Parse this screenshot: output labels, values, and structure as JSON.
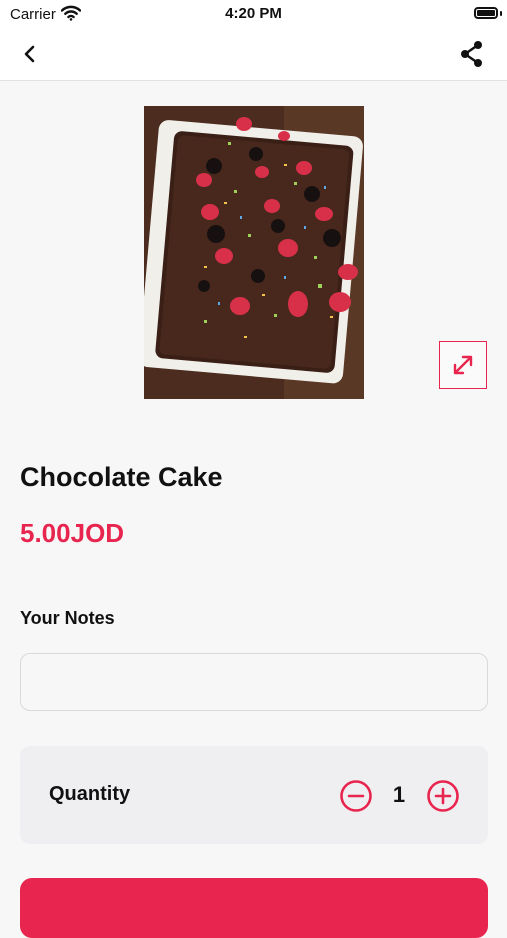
{
  "status_bar": {
    "carrier": "Carrier",
    "time": "4:20 PM"
  },
  "nav": {
    "back_icon": "chevron-left-icon",
    "share_icon": "share-icon"
  },
  "product": {
    "name": "Chocolate Cake",
    "price": "5.00JOD",
    "image_alt": "Chocolate cake with strawberries and sprinkles"
  },
  "notes": {
    "label": "Your Notes",
    "value": "",
    "placeholder": ""
  },
  "quantity": {
    "label": "Quantity",
    "value": "1"
  },
  "colors": {
    "accent": "#e8254e",
    "background": "#f7f7f8",
    "card": "#efeff2"
  }
}
